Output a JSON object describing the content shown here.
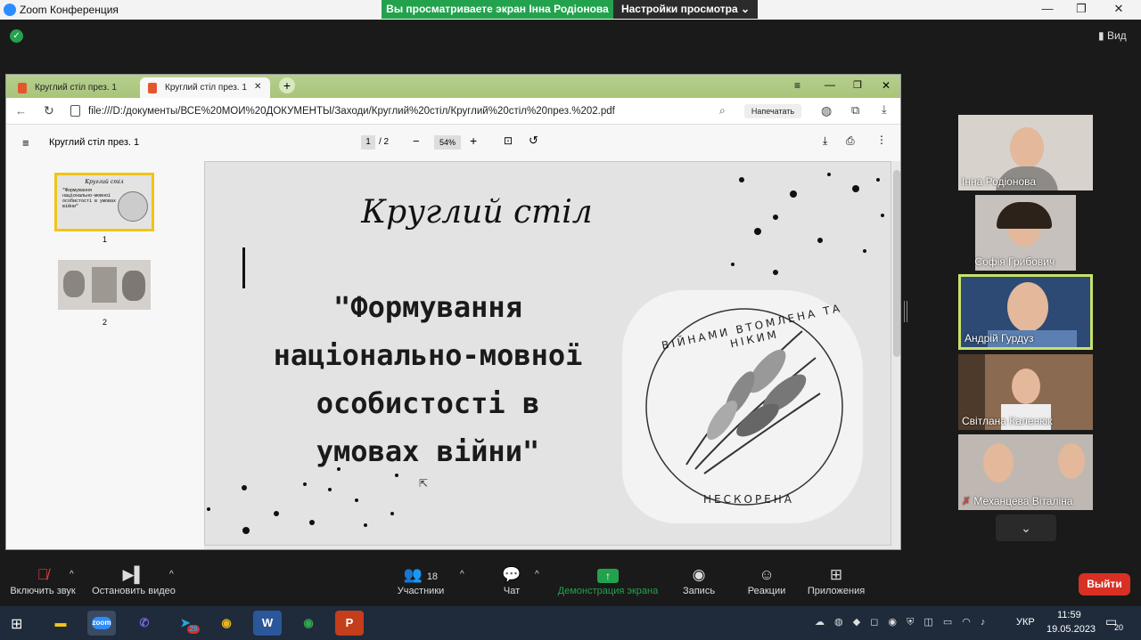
{
  "window": {
    "title": "Zoom Конференция",
    "share_banner": "Вы просматриваете экран Інна Родіонова",
    "view_settings": "Настройки просмотра",
    "view_button": "Вид"
  },
  "browser": {
    "tabs": [
      {
        "label": "Круглий стіл през. 1"
      },
      {
        "label": "Круглий стіл през. 1"
      }
    ],
    "url": "file:///D:/документы/ВСЕ%20МОИ%20ДОКУМЕНТЫ/Заходи/Круглий%20стіл/Круглий%20стіл%20през.%202.pdf",
    "print_button": "Напечатать",
    "pdf": {
      "title": "Круглий стіл през. 1",
      "page_current": "1",
      "page_total": "/ 2",
      "zoom": "54%"
    },
    "thumbnails": [
      {
        "label": "1",
        "preview_title": "Круглий стіл",
        "preview_text": "\"Формування національно-мовної особистості в умовах війни\""
      },
      {
        "label": "2"
      }
    ]
  },
  "slide": {
    "title": "Круглий стіл",
    "body_line1": "\"Формування",
    "body_line2": "національно-мовної",
    "body_line3": "особистості в",
    "body_line4": "умовах війни\"",
    "seal_top": "ВІЙНАМИ ВТОМЛЕНА ТА НІКИМ",
    "seal_bottom": "НЕСКОРЕНА"
  },
  "participants": [
    {
      "name": "Інна Родіонова",
      "muted": false,
      "active": false
    },
    {
      "name": "Софія Грибович",
      "muted": true,
      "active": false
    },
    {
      "name": "Андрій Гурдуз",
      "muted": false,
      "active": true
    },
    {
      "name": "Світлана Каленюк",
      "muted": false,
      "active": false
    },
    {
      "name": "Механцева Віталіна",
      "muted": true,
      "active": false
    }
  ],
  "toolbar": {
    "unmute": "Включить звук",
    "stop_video": "Остановить видео",
    "participants": "Участники",
    "participants_count": "18",
    "chat": "Чат",
    "share_screen": "Демонстрация экрана",
    "record": "Запись",
    "reactions": "Реакции",
    "apps": "Приложения",
    "leave": "Выйти"
  },
  "taskbar": {
    "language": "УКР",
    "time": "11:59",
    "date": "19.05.2023",
    "notifications": "20",
    "telegram_badge": "29"
  },
  "colors": {
    "share_green": "#23a24d",
    "leave_red": "#d93025",
    "active_speaker": "#c8e26b",
    "tab_green": "#a8c47a"
  }
}
